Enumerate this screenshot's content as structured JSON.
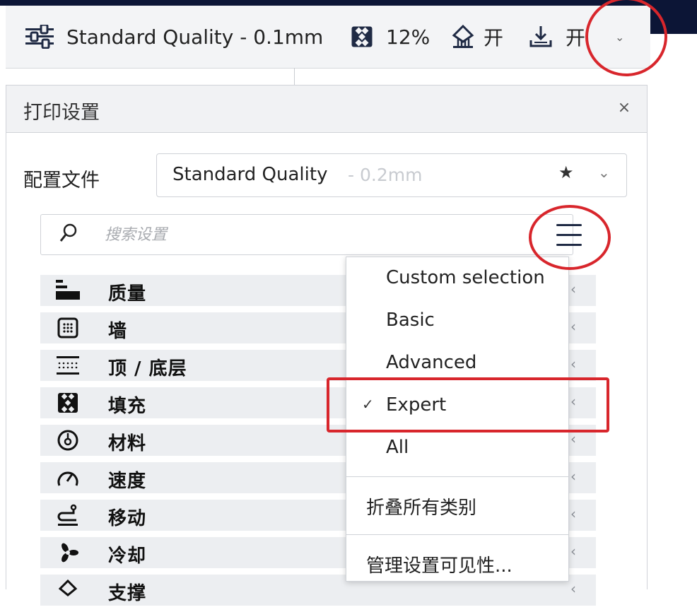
{
  "toolbar": {
    "profile_label": "Standard Quality - 0.1mm",
    "infill_value": "12%",
    "support_value": "开",
    "adhesion_value": "开"
  },
  "panel": {
    "title": "打印设置",
    "close_label": "×",
    "profile_label": "配置文件",
    "profile_name": "Standard Quality",
    "profile_sub": " - 0.2mm",
    "search_placeholder": "搜索设置"
  },
  "categories": [
    {
      "label": "质量",
      "icon": "quality-icon"
    },
    {
      "label": "墙",
      "icon": "wall-icon"
    },
    {
      "label": "顶 / 底层",
      "icon": "top-bottom-icon"
    },
    {
      "label": "填充",
      "icon": "infill-icon"
    },
    {
      "label": "材料",
      "icon": "material-icon"
    },
    {
      "label": "速度",
      "icon": "speed-icon"
    },
    {
      "label": "移动",
      "icon": "travel-icon"
    },
    {
      "label": "冷却",
      "icon": "cooling-icon"
    },
    {
      "label": "支撑",
      "icon": "support-icon"
    }
  ],
  "visibility_menu": {
    "items": [
      "Custom selection",
      "Basic",
      "Advanced",
      "Expert",
      "All"
    ],
    "selected": "Expert",
    "collapse_all": "折叠所有类别",
    "manage_visibility": "管理设置可见性..."
  },
  "colors": {
    "annotation": "#d8262c",
    "header_dark": "#0c1536",
    "category_bg": "#eceef1"
  }
}
